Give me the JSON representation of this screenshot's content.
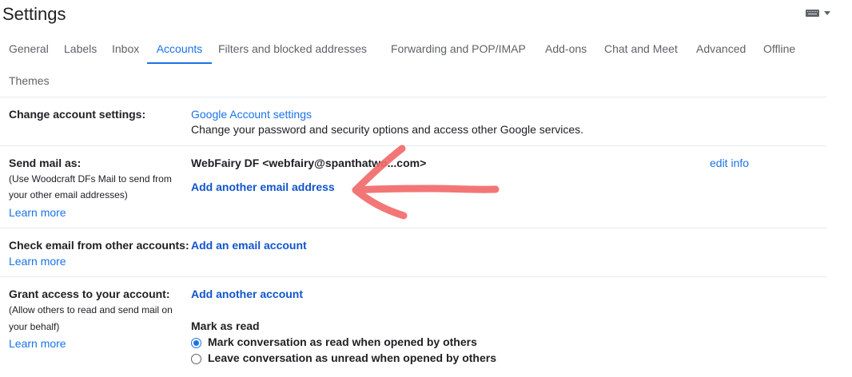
{
  "header": {
    "title": "Settings"
  },
  "tabs": [
    {
      "label": "General"
    },
    {
      "label": "Labels"
    },
    {
      "label": "Inbox"
    },
    {
      "label": "Accounts"
    },
    {
      "label": "Filters and blocked addresses"
    },
    {
      "label": "Forwarding and POP/IMAP"
    },
    {
      "label": "Add-ons"
    },
    {
      "label": "Chat and Meet"
    },
    {
      "label": "Advanced"
    },
    {
      "label": "Offline"
    },
    {
      "label": "Themes"
    }
  ],
  "active_tab": "Accounts",
  "sections": {
    "change": {
      "label": "Change account settings:",
      "link": "Google Account settings",
      "desc": "Change your password and security options and access other Google services."
    },
    "send_as": {
      "label": "Send mail as:",
      "sub1": "(Use Woodcraft DFs Mail to send from",
      "sub2": "your other email addresses)",
      "learn": "Learn more",
      "identity": "WebFairy DF <webfairy@spanthatwo...com>",
      "edit": "edit info",
      "add": "Add another email address"
    },
    "check": {
      "label": "Check email from other accounts:",
      "learn": "Learn more",
      "add": "Add an email account"
    },
    "grant": {
      "label": "Grant access to your account:",
      "sub1": "(Allow others to read and send mail on",
      "sub2": "your behalf)",
      "learn": "Learn more",
      "add": "Add another account",
      "mark_title": "Mark as read",
      "opt1": "Mark conversation as read when opened by others",
      "opt2": "Leave conversation as unread when opened by others"
    }
  },
  "icons": {
    "input_tools": "keyboard-icon",
    "dropdown": "caret-down-icon"
  },
  "colors": {
    "accent": "#1a73e8",
    "link_bold": "#1155cc",
    "annotation": "#f26b6b"
  }
}
